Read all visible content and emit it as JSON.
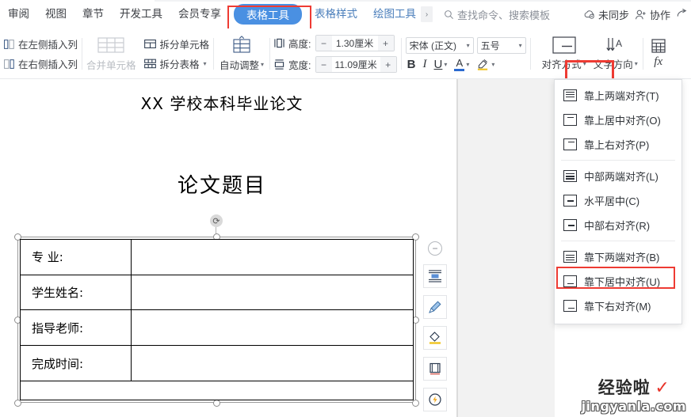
{
  "tabs": [
    {
      "label": "审阅",
      "state": "normal"
    },
    {
      "label": "视图",
      "state": "normal"
    },
    {
      "label": "章节",
      "state": "normal"
    },
    {
      "label": "开发工具",
      "state": "normal"
    },
    {
      "label": "会员专享",
      "state": "normal"
    }
  ],
  "active_tab": "表格工具",
  "tabs_after": [
    {
      "label": "表格样式",
      "state": "blue"
    },
    {
      "label": "绘图工具",
      "state": "blue"
    }
  ],
  "tab_overflow_chevron": "›",
  "search": {
    "icon": "search-icon",
    "placeholder": "查找命令、搜索模板"
  },
  "topright": [
    {
      "icon": "cloud-sync-icon",
      "label": "未同步"
    },
    {
      "icon": "collaborate-icon",
      "label": "协作"
    },
    {
      "icon": "share-icon",
      "label": ""
    }
  ],
  "ribbon": {
    "insert_column": [
      {
        "icon": "insert-column-left-icon",
        "label": "在左侧插入列"
      },
      {
        "icon": "insert-column-right-icon",
        "label": "在右侧插入列"
      }
    ],
    "merge": {
      "icon": "merge-cells-icon",
      "label": "合并单元格",
      "disabled": true
    },
    "split": [
      {
        "icon": "split-cell-icon",
        "label": "拆分单元格",
        "caret": false
      },
      {
        "icon": "split-table-icon",
        "label": "拆分表格",
        "caret": true
      }
    ],
    "autofit": {
      "icon": "auto-fit-icon",
      "label": "自动调整",
      "caret": true
    },
    "size": {
      "height": {
        "icon": "row-height-icon",
        "label": "高度:",
        "value": "1.30厘米",
        "minus": "−",
        "plus": "+"
      },
      "width": {
        "icon": "col-width-icon",
        "label": "宽度:",
        "value": "11.09厘米",
        "minus": "−",
        "plus": "+"
      }
    },
    "font": {
      "family": "宋体 (正文)",
      "size": "五号",
      "bold": "B",
      "italic": "I",
      "underline": "U",
      "text_color": "A",
      "highlight": "highlight-icon"
    },
    "align_button": {
      "icon": "align-bottom-right-icon",
      "label": "对齐方式",
      "caret": true
    },
    "text_direction": {
      "icon": "text-direction-icon",
      "label": "文字方向",
      "caret": true
    },
    "table_calc": {
      "icon": "table-calc-icon",
      "label": ""
    },
    "formula": {
      "icon": "formula-fx-icon",
      "label": "fx"
    }
  },
  "align_menu": {
    "groups": [
      [
        {
          "icon": "align-top-justify-icon",
          "label": "靠上两端对齐(T)"
        },
        {
          "icon": "align-top-center-icon",
          "label": "靠上居中对齐(O)"
        },
        {
          "icon": "align-top-right-icon",
          "label": "靠上右对齐(P)"
        }
      ],
      [
        {
          "icon": "align-middle-justify-icon",
          "label": "中部两端对齐(L)"
        },
        {
          "icon": "align-middle-center-icon",
          "label": "水平居中(C)"
        },
        {
          "icon": "align-middle-right-icon",
          "label": "中部右对齐(R)"
        }
      ],
      [
        {
          "icon": "align-bottom-justify-icon",
          "label": "靠下两端对齐(B)"
        },
        {
          "icon": "align-bottom-center-icon",
          "label": "靠下居中对齐(U)"
        },
        {
          "icon": "align-bottom-right-icon",
          "label": "靠下右对齐(M)"
        }
      ]
    ],
    "highlighted_item": "靠下右对齐(M)"
  },
  "document": {
    "heading": "XX 学校本科毕业论文",
    "subheading": "论文题目",
    "table": {
      "rows": [
        {
          "label": "专    业:",
          "value": ""
        },
        {
          "label": "学生姓名:",
          "value": ""
        },
        {
          "label": "指导老师:",
          "value": ""
        },
        {
          "label": "完成时间:",
          "value": ""
        }
      ]
    }
  },
  "float_toolbar": [
    {
      "icon": "collapse-minus-icon"
    },
    {
      "icon": "layout-options-icon"
    },
    {
      "icon": "brush-style-icon"
    },
    {
      "icon": "fill-color-icon"
    },
    {
      "icon": "border-frame-icon"
    },
    {
      "icon": "quick-action-bulb-icon"
    }
  ],
  "watermark": {
    "line1": "经验啦",
    "check": "✓",
    "line2": "jingyanla.com"
  },
  "colors": {
    "accent": "#4a90e2",
    "highlight_box": "#ee3b33",
    "link_blue": "#4a7ebb"
  }
}
